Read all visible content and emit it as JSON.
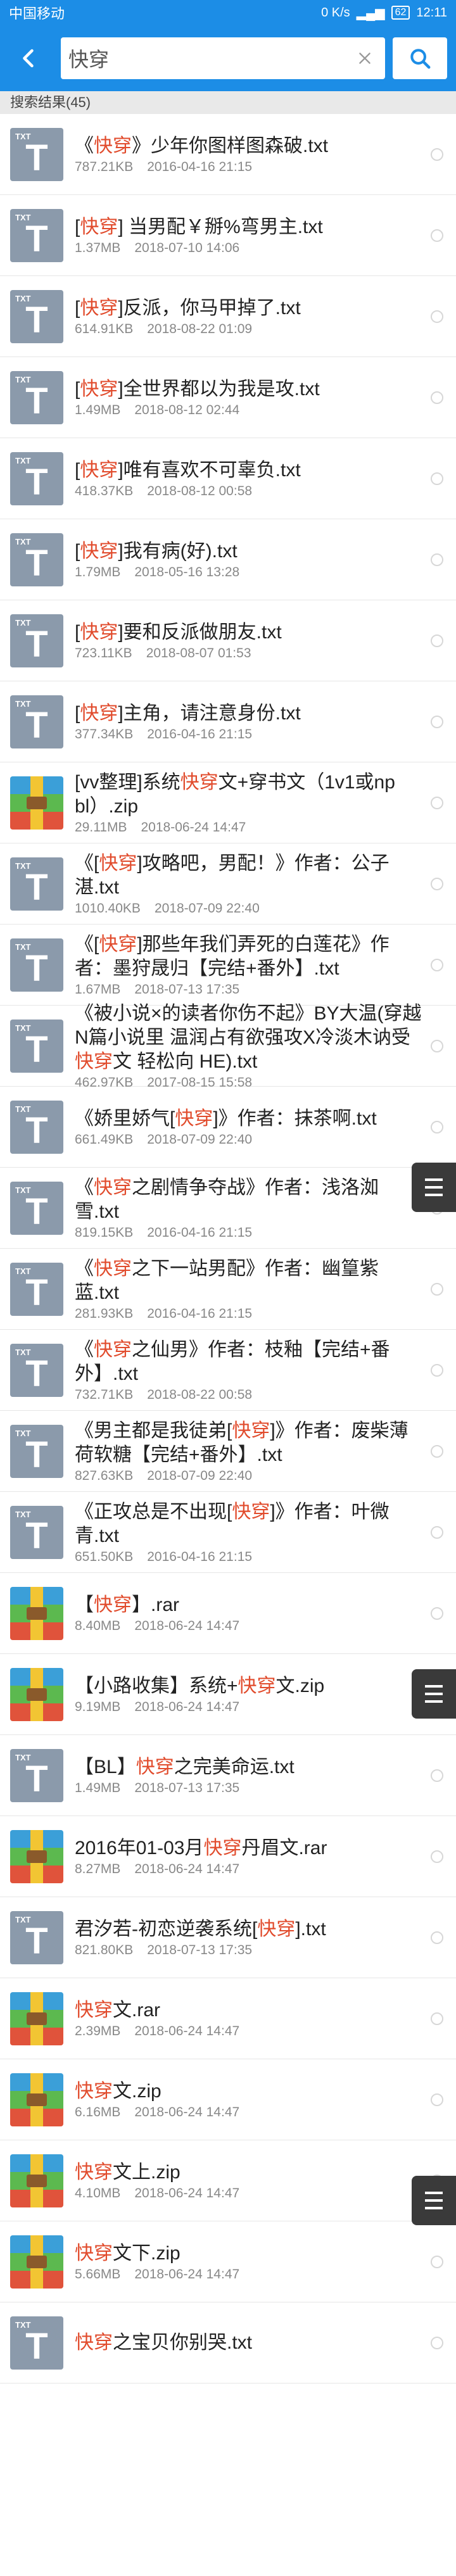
{
  "status_bar": {
    "carrier": "中国移动",
    "speed": "0 K/s",
    "battery": "62",
    "time": "12:11"
  },
  "search": {
    "query": "快穿"
  },
  "results_label": "搜索结果(45)",
  "colors": {
    "primary": "#1c8de6",
    "highlight": "#e14b2c"
  },
  "items": [
    {
      "type": "txt",
      "parts": [
        "《",
        "快穿",
        "》少年你图样图森破.txt"
      ],
      "size": "787.21KB",
      "date": "2016-04-16  21:15"
    },
    {
      "type": "txt",
      "parts": [
        "[",
        "快穿",
        "] 当男配￥掰%弯男主.txt"
      ],
      "size": "1.37MB",
      "date": "2018-07-10  14:06"
    },
    {
      "type": "txt",
      "parts": [
        "[",
        "快穿",
        "]反派，你马甲掉了.txt"
      ],
      "size": "614.91KB",
      "date": "2018-08-22  01:09"
    },
    {
      "type": "txt",
      "parts": [
        "[",
        "快穿",
        "]全世界都以为我是攻.txt"
      ],
      "size": "1.49MB",
      "date": "2018-08-12  02:44"
    },
    {
      "type": "txt",
      "parts": [
        "[",
        "快穿",
        "]唯有喜欢不可辜负.txt"
      ],
      "size": "418.37KB",
      "date": "2018-08-12  00:58"
    },
    {
      "type": "txt",
      "parts": [
        "[",
        "快穿",
        "]我有病(好).txt"
      ],
      "size": "1.79MB",
      "date": "2018-05-16  13:28"
    },
    {
      "type": "txt",
      "parts": [
        "[",
        "快穿",
        "]要和反派做朋友.txt"
      ],
      "size": "723.11KB",
      "date": "2018-08-07  01:53"
    },
    {
      "type": "txt",
      "parts": [
        "[",
        "快穿",
        "]主角，请注意身份.txt"
      ],
      "size": "377.34KB",
      "date": "2016-04-16  21:15"
    },
    {
      "type": "zip",
      "parts": [
        "[vv整理]系统",
        "快穿",
        "文+穿书文（1v1或np bl）.zip"
      ],
      "size": "29.11MB",
      "date": "2018-06-24  14:47"
    },
    {
      "type": "txt",
      "parts": [
        "《[",
        "快穿",
        "]攻略吧，男配！》作者：公子湛.txt"
      ],
      "size": "1010.40KB",
      "date": "2018-07-09  22:40"
    },
    {
      "type": "txt",
      "parts": [
        "《[",
        "快穿",
        "]那些年我们弄死的白莲花》作者：墨狩晟归【完结+番外】.txt"
      ],
      "size": "1.67MB",
      "date": "2018-07-13  17:35"
    },
    {
      "type": "txt",
      "parts": [
        "《被小说×的读者你伤不起》BY大温(穿越N篇小说里 温润占有欲强攻X冷淡木讷受 ",
        "快穿",
        "文 轻松向 HE).txt"
      ],
      "size": "462.97KB",
      "date": "2017-08-15  15:58"
    },
    {
      "type": "txt",
      "parts": [
        "《娇里娇气[",
        "快穿",
        "]》作者：抹茶啊.txt"
      ],
      "size": "661.49KB",
      "date": "2018-07-09  22:40"
    },
    {
      "type": "txt",
      "parts": [
        "《",
        "快穿",
        "之剧情争夺战》作者：浅洛洳雪.txt"
      ],
      "size": "819.15KB",
      "date": "2016-04-16  21:15"
    },
    {
      "type": "txt",
      "parts": [
        "《",
        "快穿",
        "之下一站男配》作者：幽篁紫蓝.txt"
      ],
      "size": "281.93KB",
      "date": "2016-04-16  21:15"
    },
    {
      "type": "txt",
      "parts": [
        "《",
        "快穿",
        "之仙男》作者：枝釉【完结+番外】.txt"
      ],
      "size": "732.71KB",
      "date": "2018-08-22  00:58"
    },
    {
      "type": "txt",
      "parts": [
        "《男主都是我徒弟[",
        "快穿",
        "]》作者：废柴薄荷软糖【完结+番外】.txt"
      ],
      "size": "827.63KB",
      "date": "2018-07-09  22:40"
    },
    {
      "type": "txt",
      "parts": [
        "《正攻总是不出现[",
        "快穿",
        "]》作者：叶微青.txt"
      ],
      "size": "651.50KB",
      "date": "2016-04-16  21:15"
    },
    {
      "type": "zip",
      "parts": [
        "【",
        "快穿",
        "】.rar"
      ],
      "size": "8.40MB",
      "date": "2018-06-24  14:47"
    },
    {
      "type": "zip",
      "parts": [
        "【小路收集】系统+",
        "快穿",
        "文.zip"
      ],
      "size": "9.19MB",
      "date": "2018-06-24  14:47"
    },
    {
      "type": "txt",
      "parts": [
        "【BL】",
        "快穿",
        "之完美命运.txt"
      ],
      "size": "1.49MB",
      "date": "2018-07-13  17:35"
    },
    {
      "type": "zip",
      "parts": [
        "2016年01-03月",
        "快穿",
        "丹眉文.rar"
      ],
      "size": "8.27MB",
      "date": "2018-06-24  14:47"
    },
    {
      "type": "txt",
      "parts": [
        "君汐若-初恋逆袭系统[",
        "快穿",
        "].txt"
      ],
      "size": "821.80KB",
      "date": "2018-07-13  17:35"
    },
    {
      "type": "zip",
      "parts": [
        "",
        "快穿",
        "文.rar"
      ],
      "size": "2.39MB",
      "date": "2018-06-24  14:47"
    },
    {
      "type": "zip",
      "parts": [
        "",
        "快穿",
        "文.zip"
      ],
      "size": "6.16MB",
      "date": "2018-06-24  14:47"
    },
    {
      "type": "zip",
      "parts": [
        "",
        "快穿",
        "文上.zip"
      ],
      "size": "4.10MB",
      "date": "2018-06-24  14:47"
    },
    {
      "type": "zip",
      "parts": [
        "",
        "快穿",
        "文下.zip"
      ],
      "size": "5.66MB",
      "date": "2018-06-24  14:47"
    },
    {
      "type": "txt",
      "parts": [
        "",
        "快穿",
        "之宝贝你别哭.txt"
      ],
      "size": "",
      "date": ""
    }
  ]
}
